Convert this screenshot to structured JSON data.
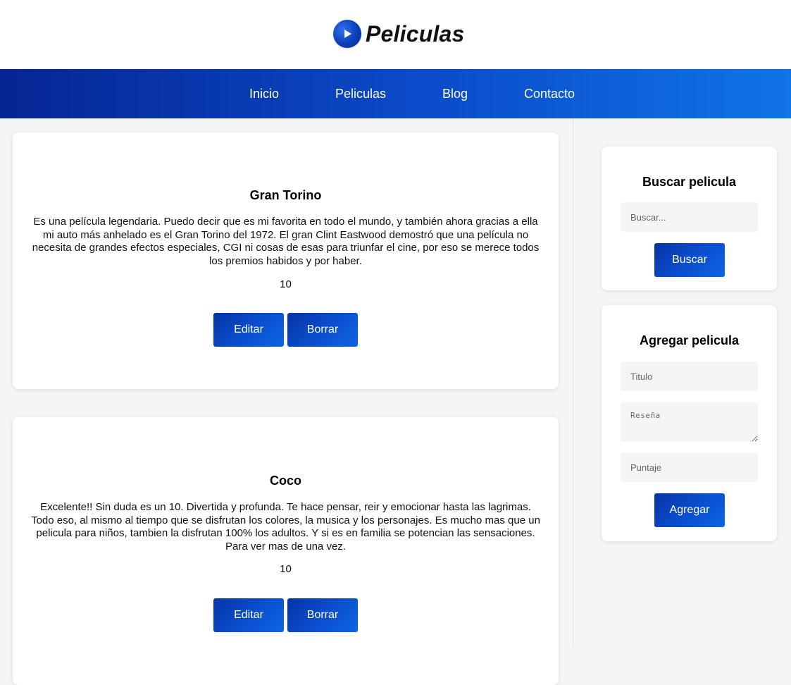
{
  "brand": {
    "title": "Peliculas",
    "logo_icon": "play-icon"
  },
  "nav": {
    "items": [
      "Inicio",
      "Peliculas",
      "Blog",
      "Contacto"
    ]
  },
  "movies": [
    {
      "title": "Gran Torino",
      "review": "Es una película legendaria. Puedo decir que es mi favorita en todo el mundo, y también ahora gracias a ella mi auto más anhelado es el Gran Torino del 1972. El gran Clint Eastwood demostró que una película no necesita de grandes efectos especiales, CGI ni cosas de esas para triunfar el cine, por eso se merece todos los premios habidos y por haber.",
      "score": "10",
      "edit_label": "Editar",
      "delete_label": "Borrar"
    },
    {
      "title": "Coco",
      "review": "Excelente!! Sin duda es un 10. Divertida y profunda. Te hace pensar, reir y emocionar hasta las lagrimas. Todo eso, al mismo al tiempo que se disfrutan los colores, la musica y los personajes. Es mucho mas que un pelicula para niños, tambien la disfrutan 100% los adultos. Y si es en familia se potencian las sensaciones. Para ver mas de una vez.",
      "score": "10",
      "edit_label": "Editar",
      "delete_label": "Borrar"
    }
  ],
  "search": {
    "title": "Buscar pelicula",
    "placeholder": "Buscar...",
    "button_label": "Buscar"
  },
  "add": {
    "title": "Agregar pelicula",
    "title_placeholder": "Titulo",
    "review_placeholder": "Reseña",
    "score_placeholder": "Puntaje",
    "button_label": "Agregar"
  },
  "colors": {
    "nav_gradient_start": "#062593",
    "nav_gradient_end": "#0f74e6",
    "button_blue": "#0b4fd0",
    "page_bg": "#f4f5f7"
  }
}
